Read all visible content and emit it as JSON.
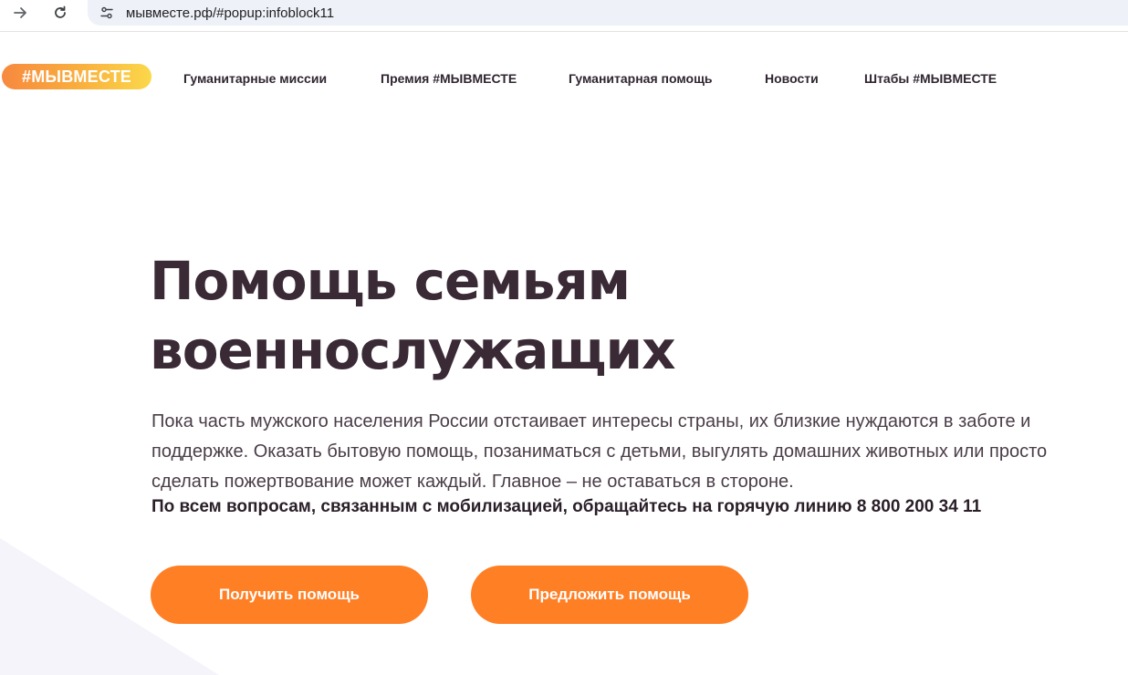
{
  "browser": {
    "url": "мывместе.рф/#popup:infoblock11",
    "forward_icon": "arrow-right-icon",
    "reload_icon": "reload-icon",
    "site_info_icon": "tune-icon"
  },
  "header": {
    "logo": "#МЫВМЕСТЕ",
    "nav": [
      "Гуманитарные миссии",
      "Премия #МЫВМЕСТЕ",
      "Гуманитарная помощь",
      "Новости",
      "Штабы #МЫВМЕСТЕ"
    ]
  },
  "hero": {
    "title_line1": "Помощь семьям",
    "title_line2": "военнослужащих",
    "text": "Пока часть мужского населения России отстаивает интересы страны, их близкие нуждаются в заботе и поддержке. Оказать бытовую помощь, позаниматься с детьми, выгулять домашних животных или просто сделать пожертвование может каждый. Главное – не оставаться в стороне.",
    "hotline": "По всем вопросам, связанным с мобилизацией, обращайтесь на горячую линию 8 800 200 34 11",
    "buttons": {
      "get_help": "Получить помощь",
      "offer_help": "Предложить помощь"
    }
  },
  "colors": {
    "accent": "#ff7f25",
    "title": "#3a2a36",
    "logo_gradient": [
      "#f7893f",
      "#fbd84a"
    ]
  }
}
